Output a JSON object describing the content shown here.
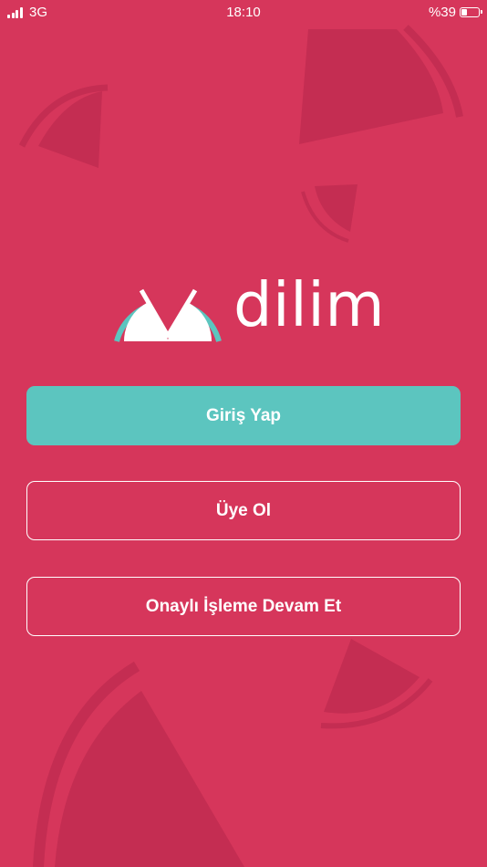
{
  "status_bar": {
    "network": "3G",
    "time": "18:10",
    "battery_percent_label": "%39",
    "battery_level": 0.39
  },
  "logo": {
    "wordmark": "dilim"
  },
  "actions": {
    "login_label": "Giriş Yap",
    "signup_label": "Üye Ol",
    "guest_label": "Onaylı İşleme Devam Et"
  },
  "colors": {
    "background": "#d6365b",
    "primary_button": "#5cc5bf",
    "decor": "#c42d52"
  }
}
